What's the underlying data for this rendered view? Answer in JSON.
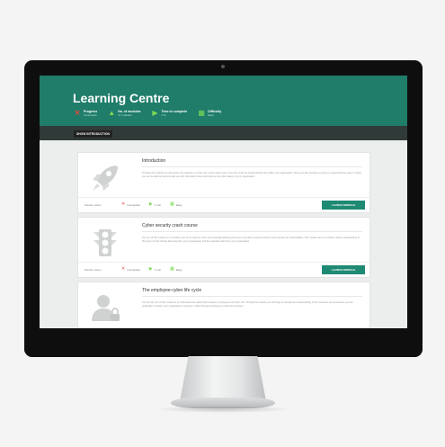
{
  "header": {
    "title": "Learning Centre",
    "stats": [
      {
        "label": "Progress",
        "value": "Incomplete",
        "icon": "x-icon",
        "color": "#e2493b"
      },
      {
        "label": "No. of modules",
        "value": "17 modules",
        "icon": "module-icon",
        "color": "#7ed957"
      },
      {
        "label": "Time to complete",
        "value": "1 hr",
        "icon": "clock-icon",
        "color": "#7ed957"
      },
      {
        "label": "Difficulty",
        "value": "Easy",
        "icon": "difficulty-icon",
        "color": "#7ed957"
      }
    ]
  },
  "subnav": {
    "button": "SHOW INTRODUCTION"
  },
  "modules": [
    {
      "title": "Introduction",
      "description": "Through this module you will explore the definition of cyber risk, where these risks come from and how predominantly they affect your organisation. Along our life examples to help you understand the ways in which you can be affected and provide you with information that could improve the cyber safety of your organisation.",
      "status_label": "Module status",
      "status": [
        "Incomplete",
        "1 min",
        "Easy"
      ],
      "button": "LAUNCH MODULE",
      "icon": "rocket-icon"
    },
    {
      "title": "Cyber security crash course",
      "description": "The aim of this module is to introduce you to the types of cyber risk financially affecting how your everyday business functions and exposes its vulnerabilities. This module aims to provide a basic understanding of the types of risks threats that arise from your organisation and the potential costs from your organisation.",
      "status_label": "Module status",
      "status": [
        "Incomplete",
        "1 min",
        "Easy"
      ],
      "button": "LAUNCH MODULE",
      "icon": "traffic-light-icon"
    },
    {
      "title": "The employee-cyber life cycle",
      "description": "The primary aim of this module is to understand the relationship between employees and cyber risk. Through the module you will begin to develop an understanding of the measures and processes you can undertake to reduce your organisation's exposure, either through employees or internal processes.",
      "icon": "user-lock-icon"
    }
  ]
}
